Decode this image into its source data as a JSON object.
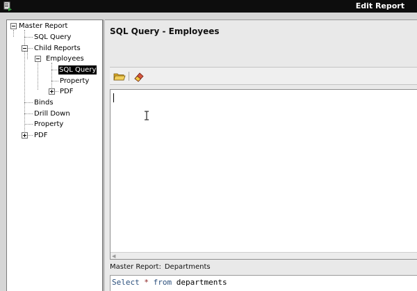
{
  "window": {
    "title": "Edit Report"
  },
  "tree": {
    "nodes": [
      {
        "label": "Master Report"
      },
      {
        "label": "SQL Query"
      },
      {
        "label": "Child Reports"
      },
      {
        "label": "Employees"
      },
      {
        "label": "SQL Query",
        "selected": true
      },
      {
        "label": "Property"
      },
      {
        "label": "PDF"
      },
      {
        "label": "Binds"
      },
      {
        "label": "Drill Down"
      },
      {
        "label": "Property"
      },
      {
        "label": "PDF"
      }
    ]
  },
  "panel": {
    "heading": "SQL Query - Employees",
    "toolbar": {
      "icons": [
        "open-folder-icon",
        "clear-eraser-icon"
      ]
    },
    "editor": {
      "text": ""
    },
    "master_label": "Master Report:",
    "master_value": "Departments",
    "master_sql": {
      "kw1": "Select",
      "star": "*",
      "kw2": "from",
      "table": "departments"
    }
  },
  "colors": {
    "titlebar": "#0d0d0d",
    "background": "#d6d6d6",
    "selected": "#000000",
    "sql_keyword": "#2a4f7c"
  }
}
